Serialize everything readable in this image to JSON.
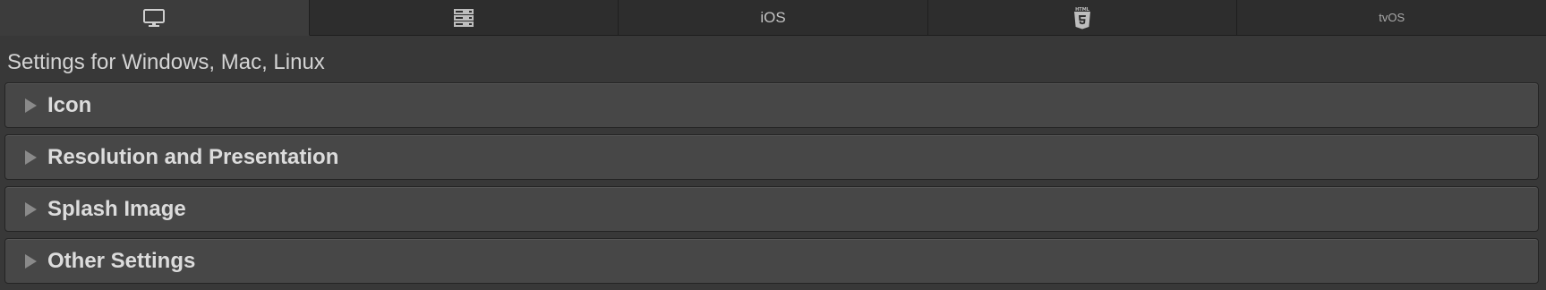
{
  "tabs": [
    {
      "icon": "monitor-icon",
      "label": "",
      "active": true
    },
    {
      "icon": "server-icon",
      "label": "",
      "active": false
    },
    {
      "icon": "",
      "label": "iOS",
      "active": false
    },
    {
      "icon": "html5-icon",
      "label": "",
      "active": false
    },
    {
      "icon": "",
      "label": "tvOS",
      "active": false
    }
  ],
  "settings_title": "Settings for Windows, Mac, Linux",
  "sections": [
    {
      "label": "Icon",
      "expanded": false
    },
    {
      "label": "Resolution and Presentation",
      "expanded": false
    },
    {
      "label": "Splash Image",
      "expanded": false
    },
    {
      "label": "Other Settings",
      "expanded": false
    }
  ],
  "colors": {
    "background": "#383838",
    "tab_bg": "#2d2d2d",
    "tab_active_bg": "#3c3c3c",
    "section_bg": "#474747",
    "text": "#d2d2d2"
  }
}
